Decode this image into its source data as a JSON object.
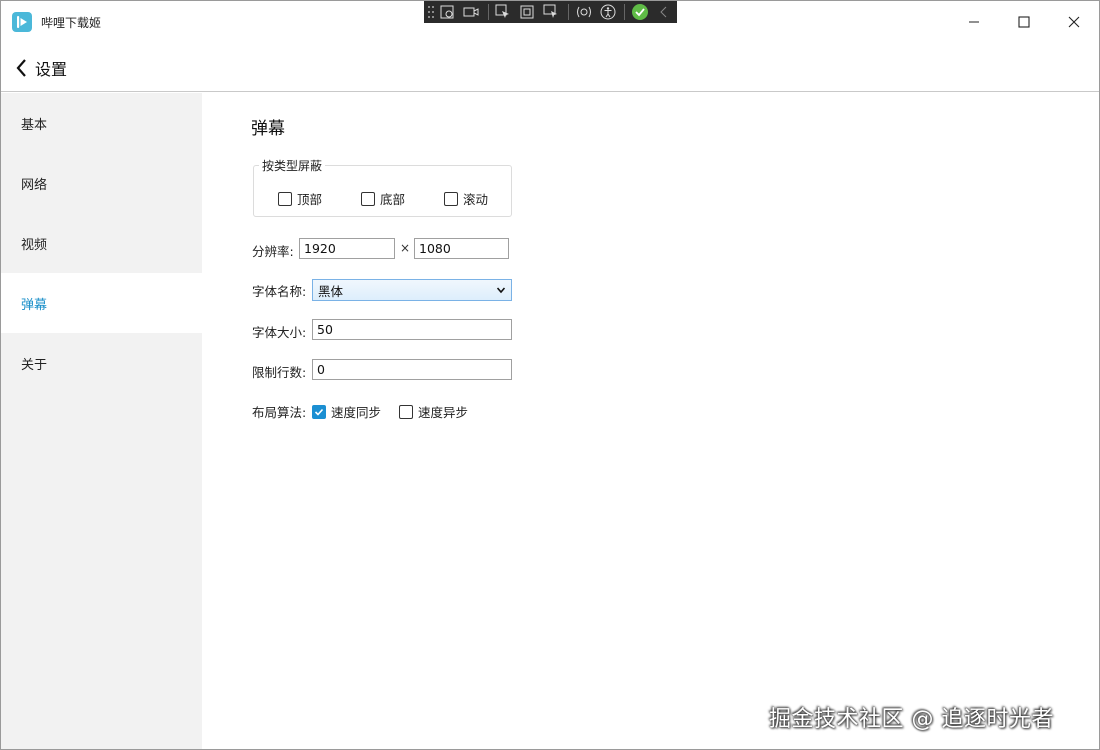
{
  "window": {
    "title": "哔哩下载姬",
    "accent_color": "#1a8fc9",
    "icon": "play-logo-icon"
  },
  "header": {
    "back_label": "设置"
  },
  "sidebar": {
    "items": [
      {
        "label": "基本",
        "active": false
      },
      {
        "label": "网络",
        "active": false
      },
      {
        "label": "视频",
        "active": false
      },
      {
        "label": "弹幕",
        "active": true
      },
      {
        "label": "关于",
        "active": false
      }
    ]
  },
  "danmaku": {
    "section_title": "弹幕",
    "block_by_type": {
      "legend": "按类型屏蔽",
      "top": {
        "label": "顶部",
        "checked": false
      },
      "bottom": {
        "label": "底部",
        "checked": false
      },
      "scroll": {
        "label": "滚动",
        "checked": false
      }
    },
    "resolution": {
      "label": "分辨率:",
      "width": "1920",
      "separator": "×",
      "height": "1080"
    },
    "font_name": {
      "label": "字体名称:",
      "value": "黑体"
    },
    "font_size": {
      "label": "字体大小:",
      "value": "50"
    },
    "line_limit": {
      "label": "限制行数:",
      "value": "0"
    },
    "layout_algorithm": {
      "label": "布局算法:",
      "sync": {
        "label": "速度同步",
        "checked": true
      },
      "async": {
        "label": "速度异步",
        "checked": false
      }
    }
  },
  "watermark": "掘金技术社区 @ 追逐时光者"
}
